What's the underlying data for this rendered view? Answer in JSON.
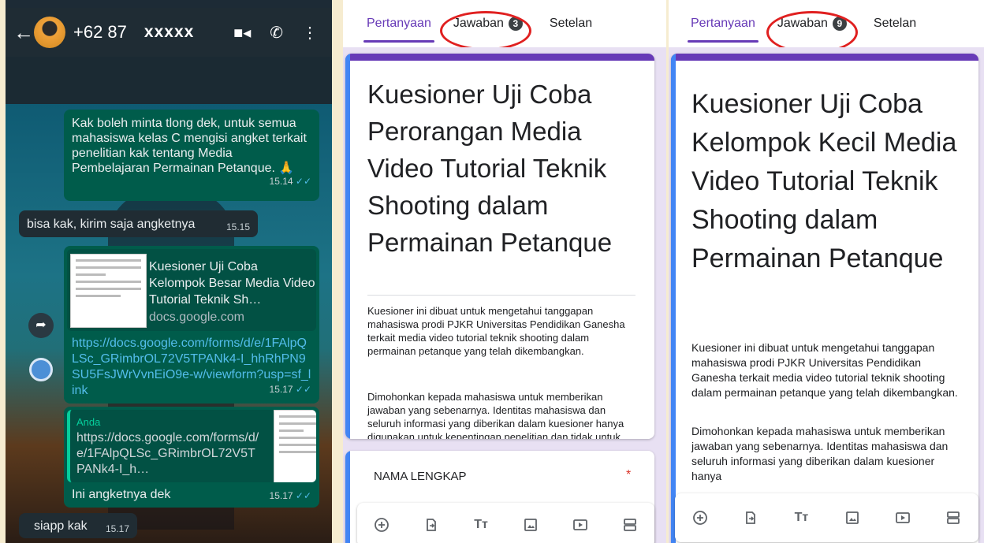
{
  "whatsapp": {
    "contact_phone": "+62 87",
    "contact_name": "xxxxx",
    "messages": [
      {
        "text": "Kak boleh minta tlong dek, untuk semua mahasiswa kelas C mengisi angket terkait penelitian kak tentang Media Pembelajaran Permainan Petanque. 🙏",
        "time": "15.14"
      },
      {
        "text": "bisa kak, kirim saja angketnya",
        "time": "15.15"
      },
      {
        "preview_title": "Kuesioner Uji Coba Kelompok Besar Media Video Tutorial Teknik Sh…",
        "preview_domain": "docs.google.com",
        "link": "https://docs.google.com/forms/d/e/1FAlpQLSc_GRimbrOL72V5TPANk4-I_hhRhPN9SU5FsJWrVvnEiO9e-w/viewform?usp=sf_link",
        "time": "15.17"
      },
      {
        "quote_author": "Anda",
        "quote_text": "https://docs.google.com/forms/d/e/1FAlpQLSc_GRimbrOL72V5TPANk4-I_h…",
        "text": "Ini angketnya dek",
        "time": "15.17"
      },
      {
        "text": "siapp kak",
        "time": "15.17"
      }
    ]
  },
  "form_left": {
    "tabs": [
      "Pertanyaan",
      "Jawaban",
      "Setelan"
    ],
    "responses_count": "3",
    "title": "Kuesioner Uji Coba Perorangan Media Video Tutorial Teknik Shooting dalam Permainan Petanque",
    "description_1": "Kuesioner ini dibuat untuk mengetahui tanggapan mahasiswa prodi PJKR Universitas Pendidikan Ganesha terkait media video tutorial teknik shooting dalam permainan petanque yang telah dikembangkan.",
    "description_2": "Dimohonkan kepada mahasiswa untuk memberikan jawaban yang sebenarnya. Identitas mahasiswa dan seluruh informasi yang diberikan dalam kuesioner hanya digunakan untuk kepentingan penelitian dan tidak untuk disebarluaskan.",
    "question_1": "NAMA LENGKAP",
    "required_mark": "*"
  },
  "form_right": {
    "tabs": [
      "Pertanyaan",
      "Jawaban",
      "Setelan"
    ],
    "responses_count": "9",
    "title": "Kuesioner Uji Coba Kelompok Kecil Media Video Tutorial Teknik Shooting dalam Permainan Petanque",
    "description_1": "Kuesioner ini dibuat untuk mengetahui tanggapan mahasiswa prodi PJKR Universitas Pendidikan Ganesha terkait media video tutorial teknik shooting dalam permainan petanque yang telah dikembangkan.",
    "description_2": "Dimohonkan kepada mahasiswa untuk memberikan jawaban yang sebenarnya. Identitas mahasiswa dan seluruh informasi yang diberikan dalam kuesioner hanya"
  },
  "toolbar_icons": [
    "add-question-icon",
    "import-questions-icon",
    "add-title-icon",
    "add-image-icon",
    "add-video-icon",
    "add-section-icon"
  ],
  "toolbar_title_glyph": "Tт",
  "colors": {
    "form_accent": "#673ab7",
    "whatsapp_bubble": "#005c4b",
    "highlight_circle": "#e02020"
  }
}
